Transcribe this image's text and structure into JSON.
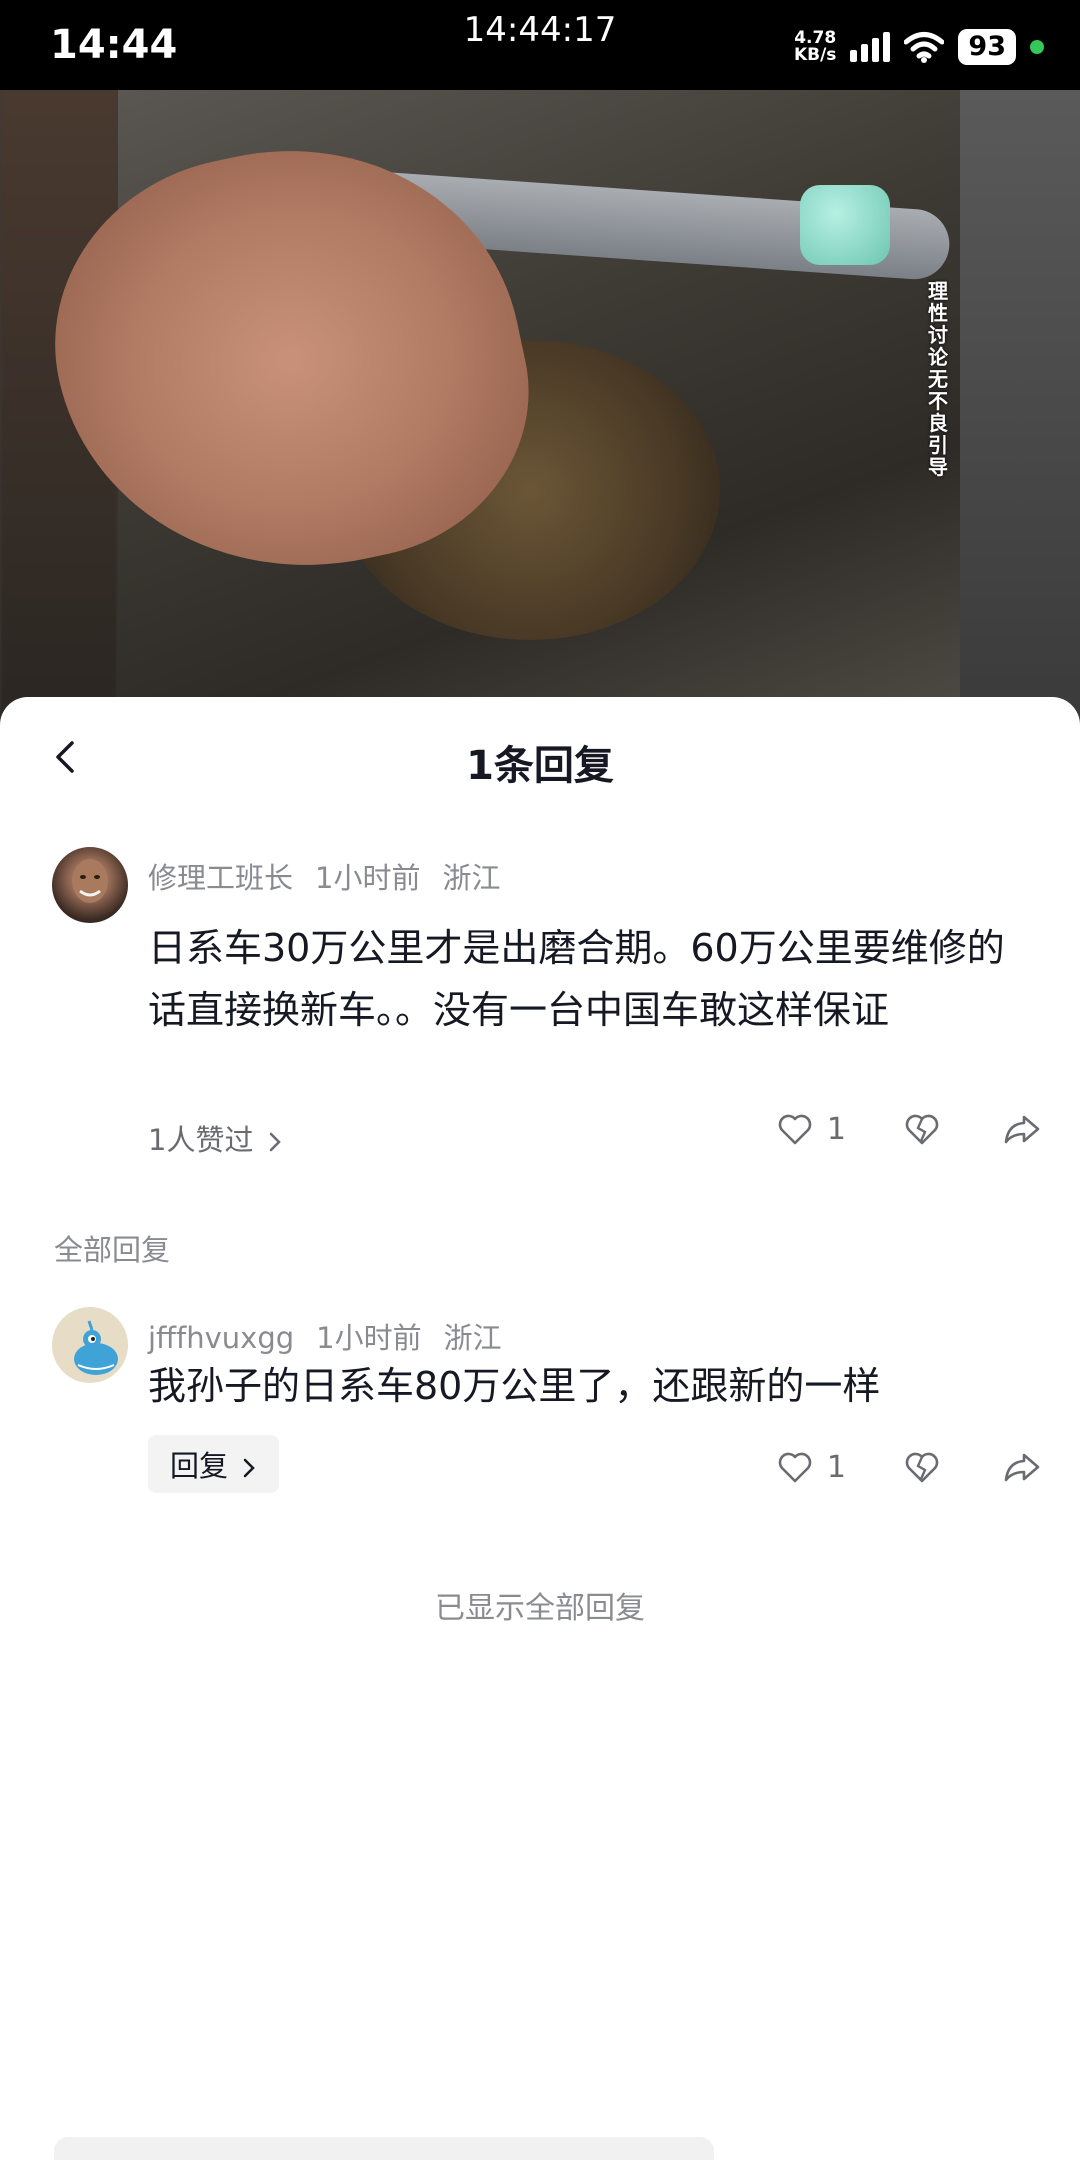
{
  "status_bar": {
    "time": "14:44",
    "clock": "14:44:17",
    "speed_value": "4.78",
    "speed_unit": "KB/s",
    "battery": "93"
  },
  "video": {
    "caption": "理性讨论 无不良引导"
  },
  "sheet": {
    "title": "1条回复"
  },
  "main_comment": {
    "author": "修理工班长",
    "time": "1小时前",
    "location": "浙江",
    "text": "日系车30万公里才是出磨合期。60万公里要维修的话直接换新车。。没有一台中国车敢这样保证",
    "liked_by": "1人赞过",
    "like_count": "1"
  },
  "all_replies_label": "全部回复",
  "reply": {
    "author": "jfffhvuxgg",
    "time": "1小时前",
    "location": "浙江",
    "text": "我孙子的日系车80万公里了，还跟新的一样",
    "reply_button": "回复",
    "like_count": "1"
  },
  "end_note": "已显示全部回复"
}
